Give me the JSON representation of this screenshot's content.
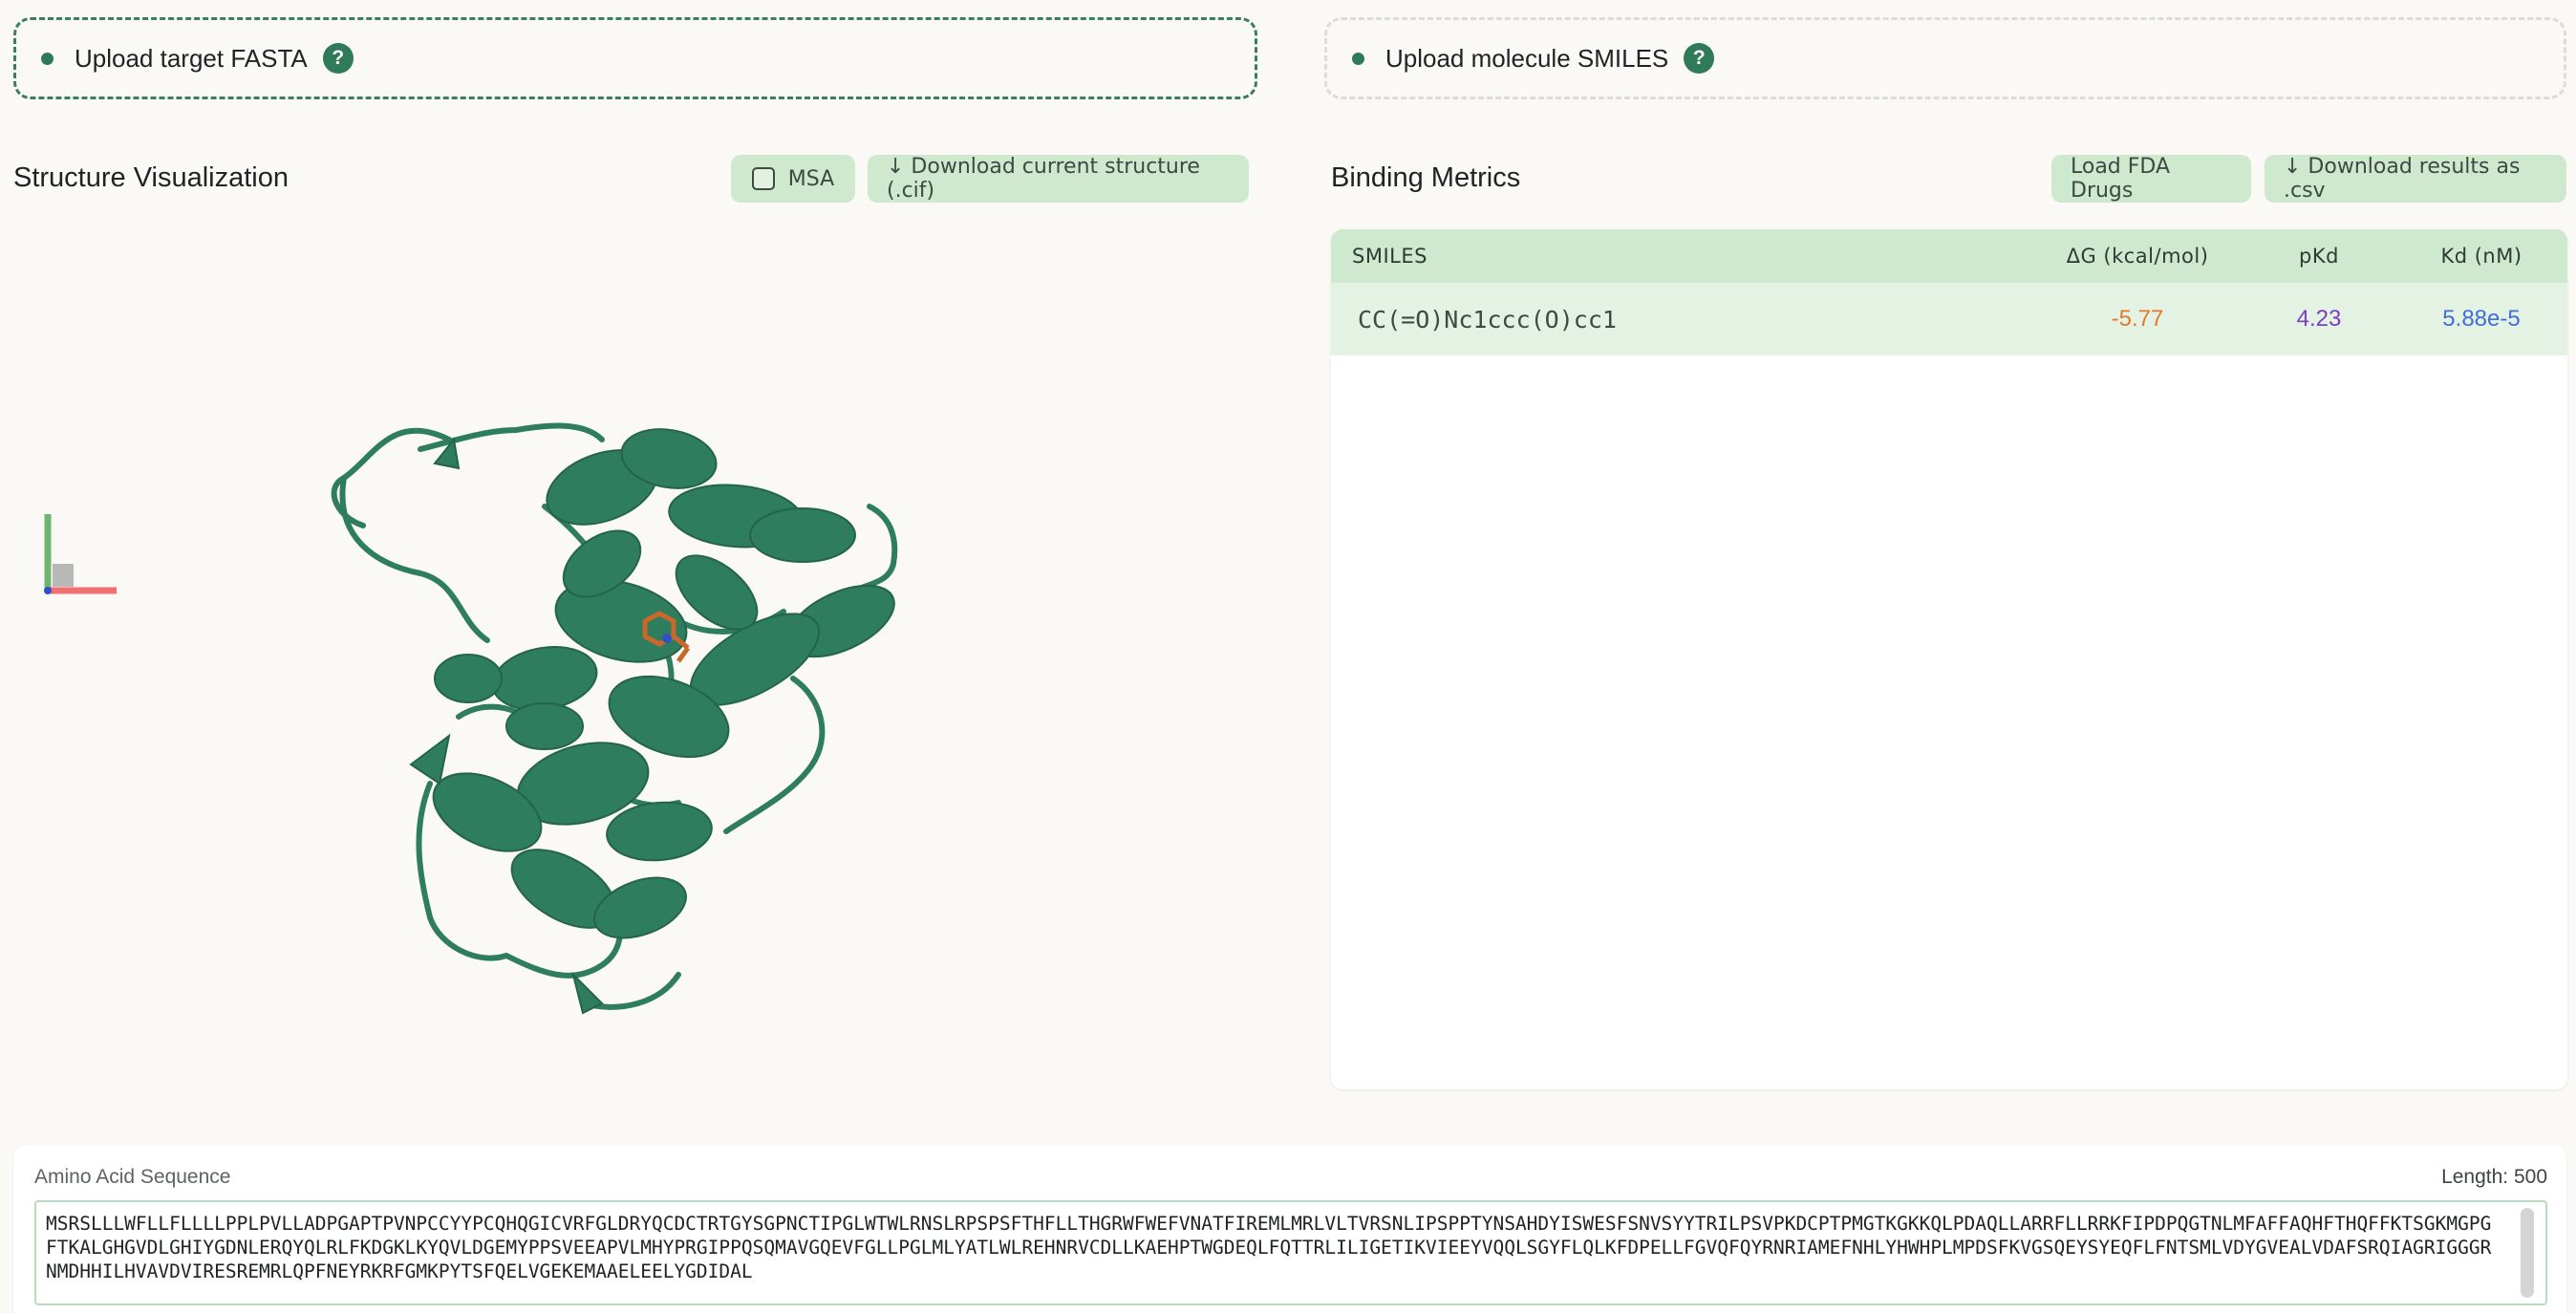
{
  "upload": {
    "fasta_label": "Upload target FASTA",
    "smiles_label": "Upload molecule SMILES",
    "help_glyph": "?"
  },
  "structure": {
    "title": "Structure Visualization",
    "msa_label": "MSA",
    "msa_checked": false,
    "download_label": "↓ Download current structure (.cif)"
  },
  "metrics": {
    "title": "Binding Metrics",
    "load_fda_label": "Load FDA Drugs",
    "download_csv_label": "↓ Download results as .csv",
    "columns": [
      "SMILES",
      "ΔG (kcal/mol)",
      "pKd",
      "Kd (nM)"
    ],
    "rows": [
      {
        "smiles": "CC(=O)Nc1ccc(O)cc1",
        "dg": "-5.77",
        "pkd": "4.23",
        "kd": "5.88e-5"
      }
    ]
  },
  "sequence": {
    "label": "Amino Acid Sequence",
    "length_text": "Length: 500",
    "value": "MSRSLLLWFLLFLLLLPPLPVLLADPGAPTPVNPCCYYPCQHQGICVRFGLDRYQCDCTRTGYSGPNCTIPGLWTWLRNSLRPSPSFTHFLLTHGRWFWEFVNATFIREMLMRLVLTVRSNLIPSPPTYNSAHDYISWESFSNVSYYTRILPSVPKDCPTPMGTKGKKQLPDAQLLARRFLLRRKFIPDPQGTNLMFAFFAQHFTHQFFKTSGKMGPGFTKALGHGVDLGHIYGDNLERQYQLRLFKDGKLKYQVLDGEMYPPSVEEAPVLMHYPRGIPPQSQMAVGQEVFGLLPGLMLYATLWLREHNRVCDLLKAEHPTWGDEQLFQTTRLILIGETIKVIEEYVQQLSGYFLQLKFDPELLFGVQFQYRNRIAMEFNHLYHWHPLMPDSFKVGSQEYSYEQFLFNTSMLVDYGVEALVDAFSRQIAGRIGGGRNMDHHILHVAVDVIRESREMRLQPFNEYRKRFGMKPYTSFQELVGEKEMAAELEELYGDIDAL"
  },
  "colors": {
    "accent": "#2f7a59",
    "protein": "#2e7d5e",
    "ligand": "#c8682a",
    "button_bg": "#cfe9cf",
    "dg": "#e07b2e",
    "pkd": "#7a3fc0",
    "kd": "#3d6fd6"
  }
}
